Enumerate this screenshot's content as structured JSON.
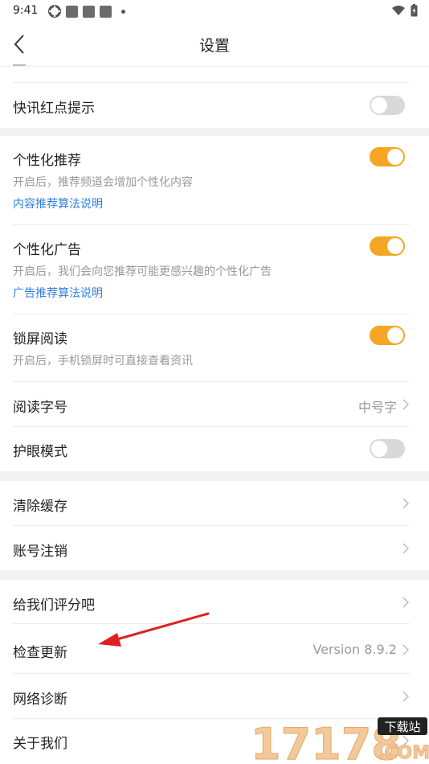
{
  "status_bar": {
    "time": "9:41"
  },
  "header": {
    "title": "设置"
  },
  "settings": {
    "flash_red_dot": {
      "label": "快讯红点提示",
      "enabled": false
    },
    "personalized_recommend": {
      "label": "个性化推荐",
      "desc": "开启后，推荐频道会增加个性化内容",
      "link": "内容推荐算法说明",
      "enabled": true
    },
    "personalized_ads": {
      "label": "个性化广告",
      "desc": "开启后，我们会向您推荐可能更感兴趣的个性化广告",
      "link": "广告推荐算法说明",
      "enabled": true
    },
    "lockscreen_reading": {
      "label": "锁屏阅读",
      "desc": "开启后，手机锁屏时可直接查看资讯",
      "enabled": true
    },
    "font_size": {
      "label": "阅读字号",
      "value": "中号字"
    },
    "eye_protection": {
      "label": "护眼模式",
      "enabled": false
    },
    "clear_cache": {
      "label": "清除缓存"
    },
    "account_cancel": {
      "label": "账号注销"
    },
    "rate_us": {
      "label": "给我们评分吧"
    },
    "check_update": {
      "label": "检查更新",
      "value": "Version 8.9.2"
    },
    "network_diagnose": {
      "label": "网络诊断"
    },
    "about_us": {
      "label": "关于我们"
    }
  },
  "colors": {
    "accent": "#f5a623",
    "link": "#2f7fe0",
    "arrow": "#e02020"
  },
  "watermark": {
    "number": "17178",
    "tag": "下载站",
    "domain": ".COM"
  }
}
